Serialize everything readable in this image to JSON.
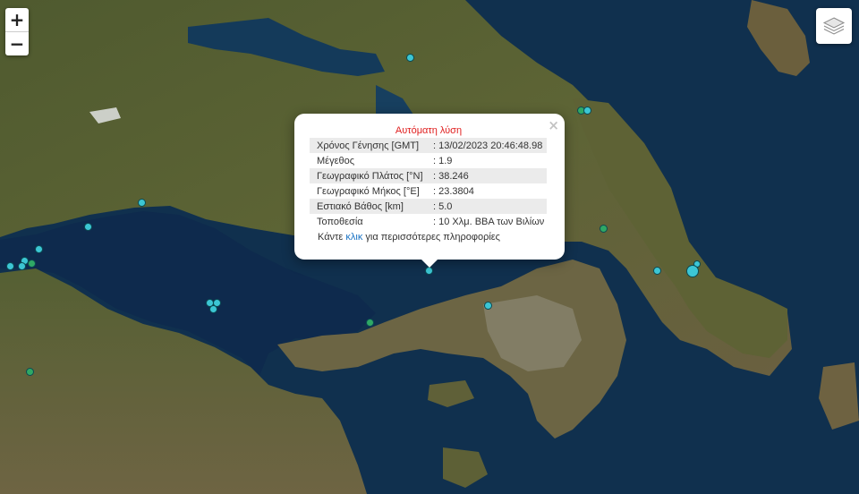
{
  "controls": {
    "zoom_in": "+",
    "zoom_out": "−"
  },
  "popup": {
    "title": "Αυτόματη λύση",
    "close": "×",
    "rows": [
      {
        "key": "Χρόνος Γένησης [GMT]",
        "value": ": 13/02/2023 20:46:48.98"
      },
      {
        "key": "Μέγεθος",
        "value": ": 1.9"
      },
      {
        "key": "Γεωγραφικό Πλάτος [°N]",
        "value": ": 38.246"
      },
      {
        "key": "Γεωγραφικό Μήκος [°E]",
        "value": ": 23.3804"
      },
      {
        "key": "Εστιακό Βάθος [km]",
        "value": ": 5.0"
      },
      {
        "key": "Τοποθεσία",
        "value": ": 10 Χλμ. ΒΒΑ των Βιλίων"
      }
    ],
    "more_prefix": "Κάντε ",
    "more_link": "κλικ",
    "more_suffix": " για περισσότερες πληροφορίες"
  },
  "colors": {
    "marker_cyan": "#3cc6d4",
    "marker_green": "#2fa865",
    "popup_title": "#e02020",
    "link": "#1a73c4"
  }
}
